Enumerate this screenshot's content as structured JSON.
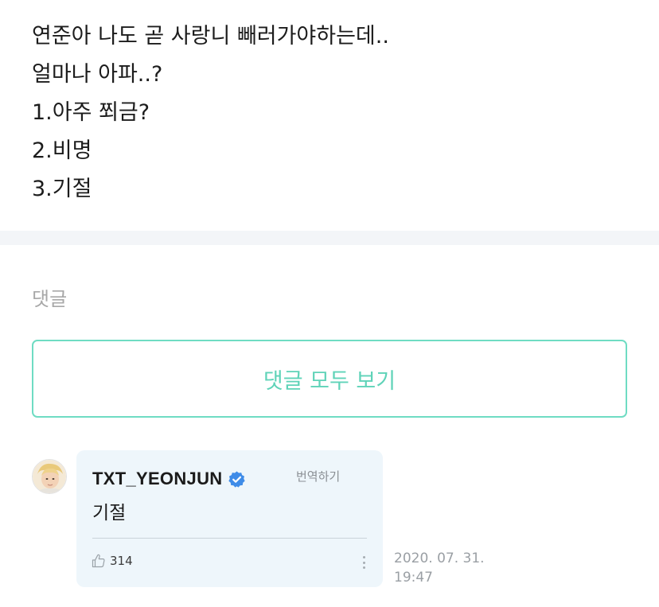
{
  "post": {
    "lines": [
      "연준아 나도 곧 사랑니 빼러가야하는데..",
      "얼마나 아파..?",
      "1.아주 쬐금?",
      "2.비명",
      "3.기절"
    ]
  },
  "comments": {
    "heading": "댓글",
    "view_all_label": "댓글 모두 보기",
    "items": [
      {
        "author": "TXT_YEONJUN",
        "verified": true,
        "translate_label": "번역하기",
        "text": "기절",
        "likes": "314",
        "date": "2020. 07. 31.",
        "time": "19:47"
      }
    ]
  },
  "colors": {
    "accent": "#5fd3b8",
    "comment_bg": "#eef6fb",
    "verified": "#3f8ce8",
    "muted": "#a8a8a8"
  },
  "icons": [
    "verified-badge-icon",
    "thumbs-up-icon",
    "more-vertical-icon",
    "avatar-image"
  ]
}
